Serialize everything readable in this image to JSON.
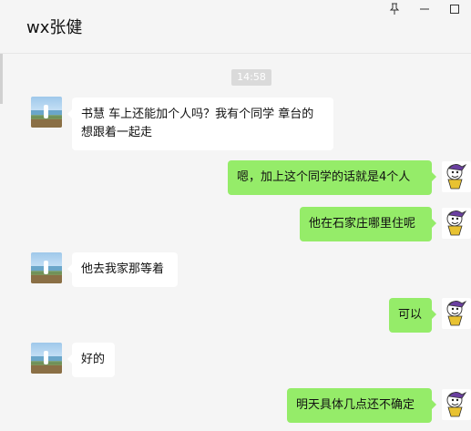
{
  "window": {
    "title": "wx张健",
    "controls": [
      "pin-icon",
      "minimize-icon",
      "maximize-icon"
    ]
  },
  "chat": {
    "timestamp": "14:58",
    "messages": [
      {
        "direction": "incoming",
        "text": "书慧  车上还能加个人吗？我有个同学  章台的 想跟着一起走"
      },
      {
        "direction": "outgoing",
        "text": "嗯，加上这个同学的话就是4个人"
      },
      {
        "direction": "outgoing",
        "text": "他在石家庄哪里住呢"
      },
      {
        "direction": "incoming",
        "text": "他去我家那等着"
      },
      {
        "direction": "outgoing",
        "text": "可以"
      },
      {
        "direction": "incoming",
        "text": "好的"
      },
      {
        "direction": "outgoing",
        "text": "明天具体几点还不确定"
      }
    ]
  },
  "colors": {
    "outgoing_bubble": "#95ec69",
    "incoming_bubble": "#ffffff",
    "background": "#f5f5f5"
  }
}
